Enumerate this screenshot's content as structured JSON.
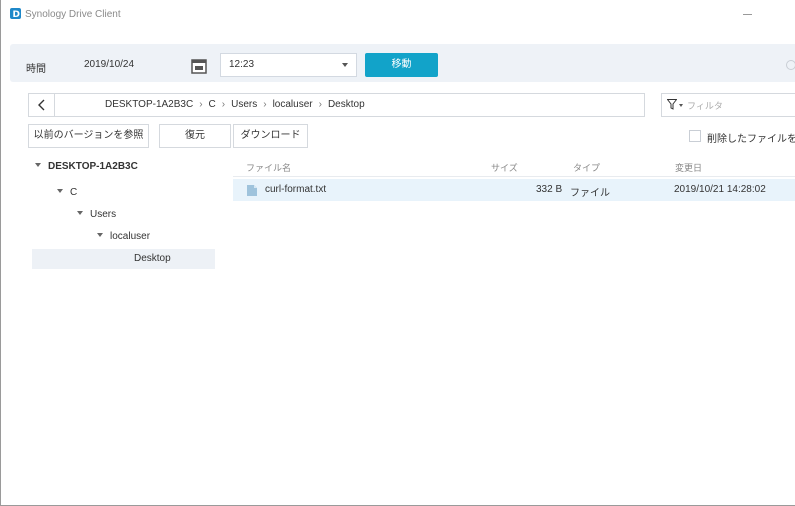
{
  "window": {
    "title": "Synology Drive Client"
  },
  "timebar": {
    "label": "時間",
    "date": "2019/10/24",
    "time": "12:23",
    "go_label": "移動",
    "accent": "#12a3c9"
  },
  "path": {
    "crumbs": [
      "DESKTOP-1A2B3C",
      "C",
      "Users",
      "localuser",
      "Desktop"
    ],
    "filter_placeholder": "フィルタ"
  },
  "actions": {
    "prev_versions": "以前のバージョンを参照",
    "restore": "復元",
    "download": "ダウンロード",
    "show_deleted": "削除したファイルを表"
  },
  "tree": {
    "root": "DESKTOP-1A2B3C",
    "drive": "C",
    "users": "Users",
    "localuser": "localuser",
    "desktop": "Desktop"
  },
  "list": {
    "headers": {
      "name": "ファイル名",
      "size": "サイズ",
      "type": "タイプ",
      "modified": "変更日"
    },
    "rows": [
      {
        "name": "curl-format.txt",
        "size": "332 B",
        "type": "ファイル",
        "modified": "2019/10/21 14:28:02"
      }
    ]
  }
}
